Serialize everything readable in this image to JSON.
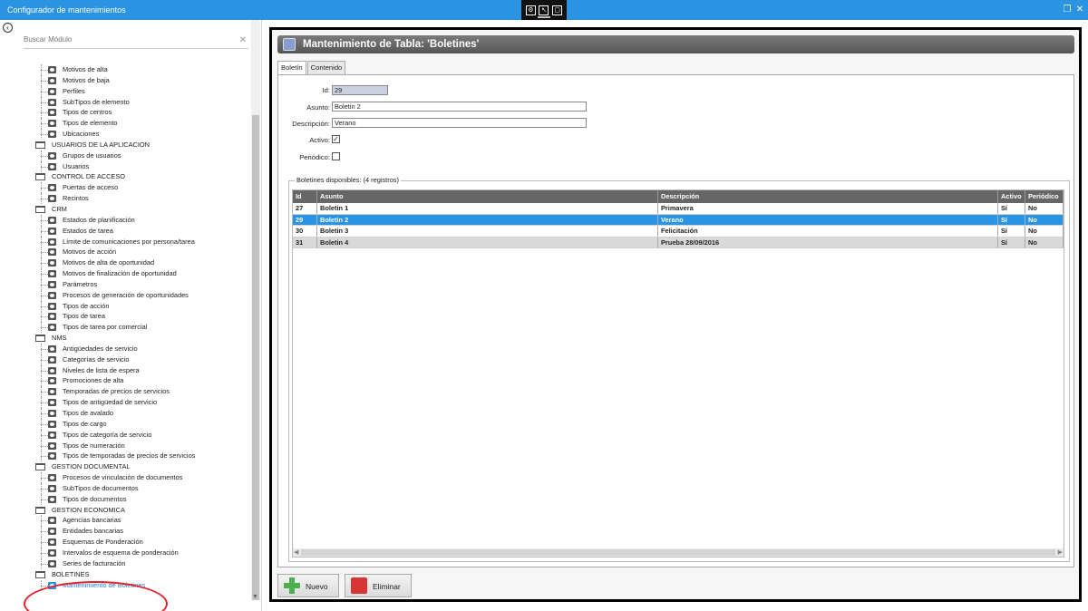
{
  "window": {
    "title": "Configurador de mantenimientos"
  },
  "sidebar": {
    "search_placeholder": "Buscar Módulo",
    "tree": [
      {
        "type": "item",
        "label": "Motivos de alta"
      },
      {
        "type": "item",
        "label": "Motivos de baja"
      },
      {
        "type": "item",
        "label": "Perfiles"
      },
      {
        "type": "item",
        "label": "SubTipos de elemento"
      },
      {
        "type": "item",
        "label": "Tipos de centros"
      },
      {
        "type": "item",
        "label": "Tipos de elemento"
      },
      {
        "type": "item",
        "label": "Ubicaciones"
      },
      {
        "type": "cat",
        "label": "USUARIOS DE LA APLICACION"
      },
      {
        "type": "item",
        "label": "Grupos de usuarios"
      },
      {
        "type": "item",
        "label": "Usuarios"
      },
      {
        "type": "cat",
        "label": "CONTROL DE ACCESO"
      },
      {
        "type": "item",
        "label": "Puertas de acceso"
      },
      {
        "type": "item",
        "label": "Recintos"
      },
      {
        "type": "cat",
        "label": "CRM"
      },
      {
        "type": "item",
        "label": "Estados de planificación"
      },
      {
        "type": "item",
        "label": "Estados de tarea"
      },
      {
        "type": "item",
        "label": "Límite de comunicaciones por persona/tarea"
      },
      {
        "type": "item",
        "label": "Motivos de acción"
      },
      {
        "type": "item",
        "label": "Motivos de alta de oportunidad"
      },
      {
        "type": "item",
        "label": "Motivos de finalización de oportunidad"
      },
      {
        "type": "item",
        "label": "Parámetros"
      },
      {
        "type": "item",
        "label": "Procesos de generación de oportunidades"
      },
      {
        "type": "item",
        "label": "Tipos de acción"
      },
      {
        "type": "item",
        "label": "Tipos de tarea"
      },
      {
        "type": "item",
        "label": "Tipos de tarea por comercial"
      },
      {
        "type": "cat",
        "label": "NMS"
      },
      {
        "type": "item",
        "label": "Antigüedades de servicio"
      },
      {
        "type": "item",
        "label": "Categorías de servicio"
      },
      {
        "type": "item",
        "label": "Niveles de lista de espera"
      },
      {
        "type": "item",
        "label": "Promociones de alta"
      },
      {
        "type": "item",
        "label": "Temporadas de precios de servicios"
      },
      {
        "type": "item",
        "label": "Tipos de antigüedad de servicio"
      },
      {
        "type": "item",
        "label": "Tipos de avalado"
      },
      {
        "type": "item",
        "label": "Tipos de cargo"
      },
      {
        "type": "item",
        "label": "Tipos de categoría de servicio"
      },
      {
        "type": "item",
        "label": "Tipos de numeración"
      },
      {
        "type": "item",
        "label": "Tipos de temporadas de precios de servicios"
      },
      {
        "type": "cat",
        "label": "GESTION DOCUMENTAL"
      },
      {
        "type": "item",
        "label": "Procesos de vinculación de documentos"
      },
      {
        "type": "item",
        "label": "SubTipos de documentos"
      },
      {
        "type": "item",
        "label": "Tipos de documentos"
      },
      {
        "type": "cat",
        "label": "GESTION ECONOMICA"
      },
      {
        "type": "item",
        "label": "Agencias bancarias"
      },
      {
        "type": "item",
        "label": "Entidades bancarias"
      },
      {
        "type": "item",
        "label": "Esquemas de Ponderación"
      },
      {
        "type": "item",
        "label": "Intervalos de esquema de ponderación"
      },
      {
        "type": "item",
        "label": "Series de facturación"
      },
      {
        "type": "cat",
        "label": "BOLETINES"
      },
      {
        "type": "item",
        "label": "Mantenimiento de Boletines",
        "selected": true
      }
    ]
  },
  "main": {
    "header": "Mantenimiento de Tabla: 'Boletines'",
    "tabs": [
      "Boletín",
      "Contenido"
    ],
    "form": {
      "id_label": "Id:",
      "id_value": "29",
      "asunto_label": "Asunto:",
      "asunto_value": "Boletin 2",
      "descripcion_label": "Descripción:",
      "descripcion_value": "Verano",
      "activo_label": "Activo:",
      "activo_checked": true,
      "periodico_label": "Periódico:",
      "periodico_checked": false
    },
    "group_label": "Boletines disponibles:  (4 registros)",
    "grid": {
      "columns": [
        "Id",
        "Asunto",
        "Descripción",
        "Activo",
        "Periódico"
      ],
      "rows": [
        [
          "27",
          "Boletin 1",
          "Primavera",
          "Sí",
          "No"
        ],
        [
          "29",
          "Boletin 2",
          "Verano",
          "Sí",
          "No"
        ],
        [
          "30",
          "Boletin 3",
          "Felicitación",
          "Sí",
          "No"
        ],
        [
          "31",
          "Boletin 4",
          "Prueba 28/09/2016",
          "Sí",
          "No"
        ]
      ],
      "selected_row": 1
    },
    "buttons": {
      "new": "Nuevo",
      "delete": "Eliminar"
    }
  },
  "colors": {
    "titlebar": "#2b94e2",
    "selection": "#2b94e2",
    "annotation": "#e0222c"
  }
}
